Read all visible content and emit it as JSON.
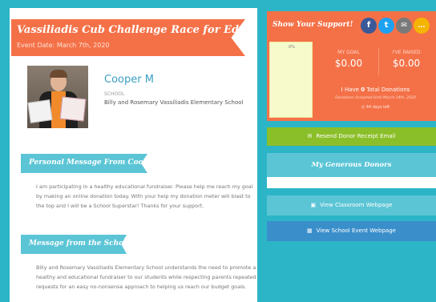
{
  "event": {
    "title": "Vassiliadis Cub Challenge Race for Education",
    "date": "Event Date: March 7th, 2020"
  },
  "student": {
    "name": "Cooper M",
    "school_label": "SCHOOL",
    "school_name": "Billy and Rosemary Vassiliadis Elementary School"
  },
  "personal_message": {
    "heading": "Personal Message From Cooper",
    "body": "I am participating in a healthy educational fundraiser. Please help me reach my goal by making an online donation today. With your help my donation meter will blast to the top and I will be a School Superstar! Thanks for your support."
  },
  "school_message": {
    "heading": "Message from the School",
    "body": "Billy and Rosemary Vassiliadis Elementary School understands the need to promote a healthy and educational fundraiser to our students while respecting parents repeated requests for an easy no-nonsense approach to helping us reach our budget goals."
  },
  "support": {
    "title": "Show Your Support!",
    "social": [
      {
        "icon": "facebook-icon",
        "glyph": "f"
      },
      {
        "icon": "twitter-icon",
        "glyph": "t"
      },
      {
        "icon": "email-icon",
        "glyph": "✉"
      },
      {
        "icon": "sms-icon",
        "glyph": "…"
      }
    ],
    "meter_percent": "0%",
    "my_goal_label": "MY GOAL",
    "my_goal_value": "$0.00",
    "raised_label": "I'VE RAISED",
    "raised_value": "$0.00",
    "donations_text_pre": "I Have ",
    "donations_count": "0",
    "donations_text_post": " Total Donations",
    "accepted_until": "Donations Accepted Until March 14th, 2020",
    "days_left": "44 days left"
  },
  "buttons": {
    "resend": "Resend Donor Receipt Email",
    "generous_donors": "My Generous Donors",
    "classroom": "View Classroom Webpage",
    "school_event": "View School Event Webpage"
  },
  "colors": {
    "background": "#2bb5c6",
    "orange": "#f47148",
    "teal": "#5bc5d6",
    "green": "#8bbf2a",
    "blue": "#3a8fcb"
  }
}
